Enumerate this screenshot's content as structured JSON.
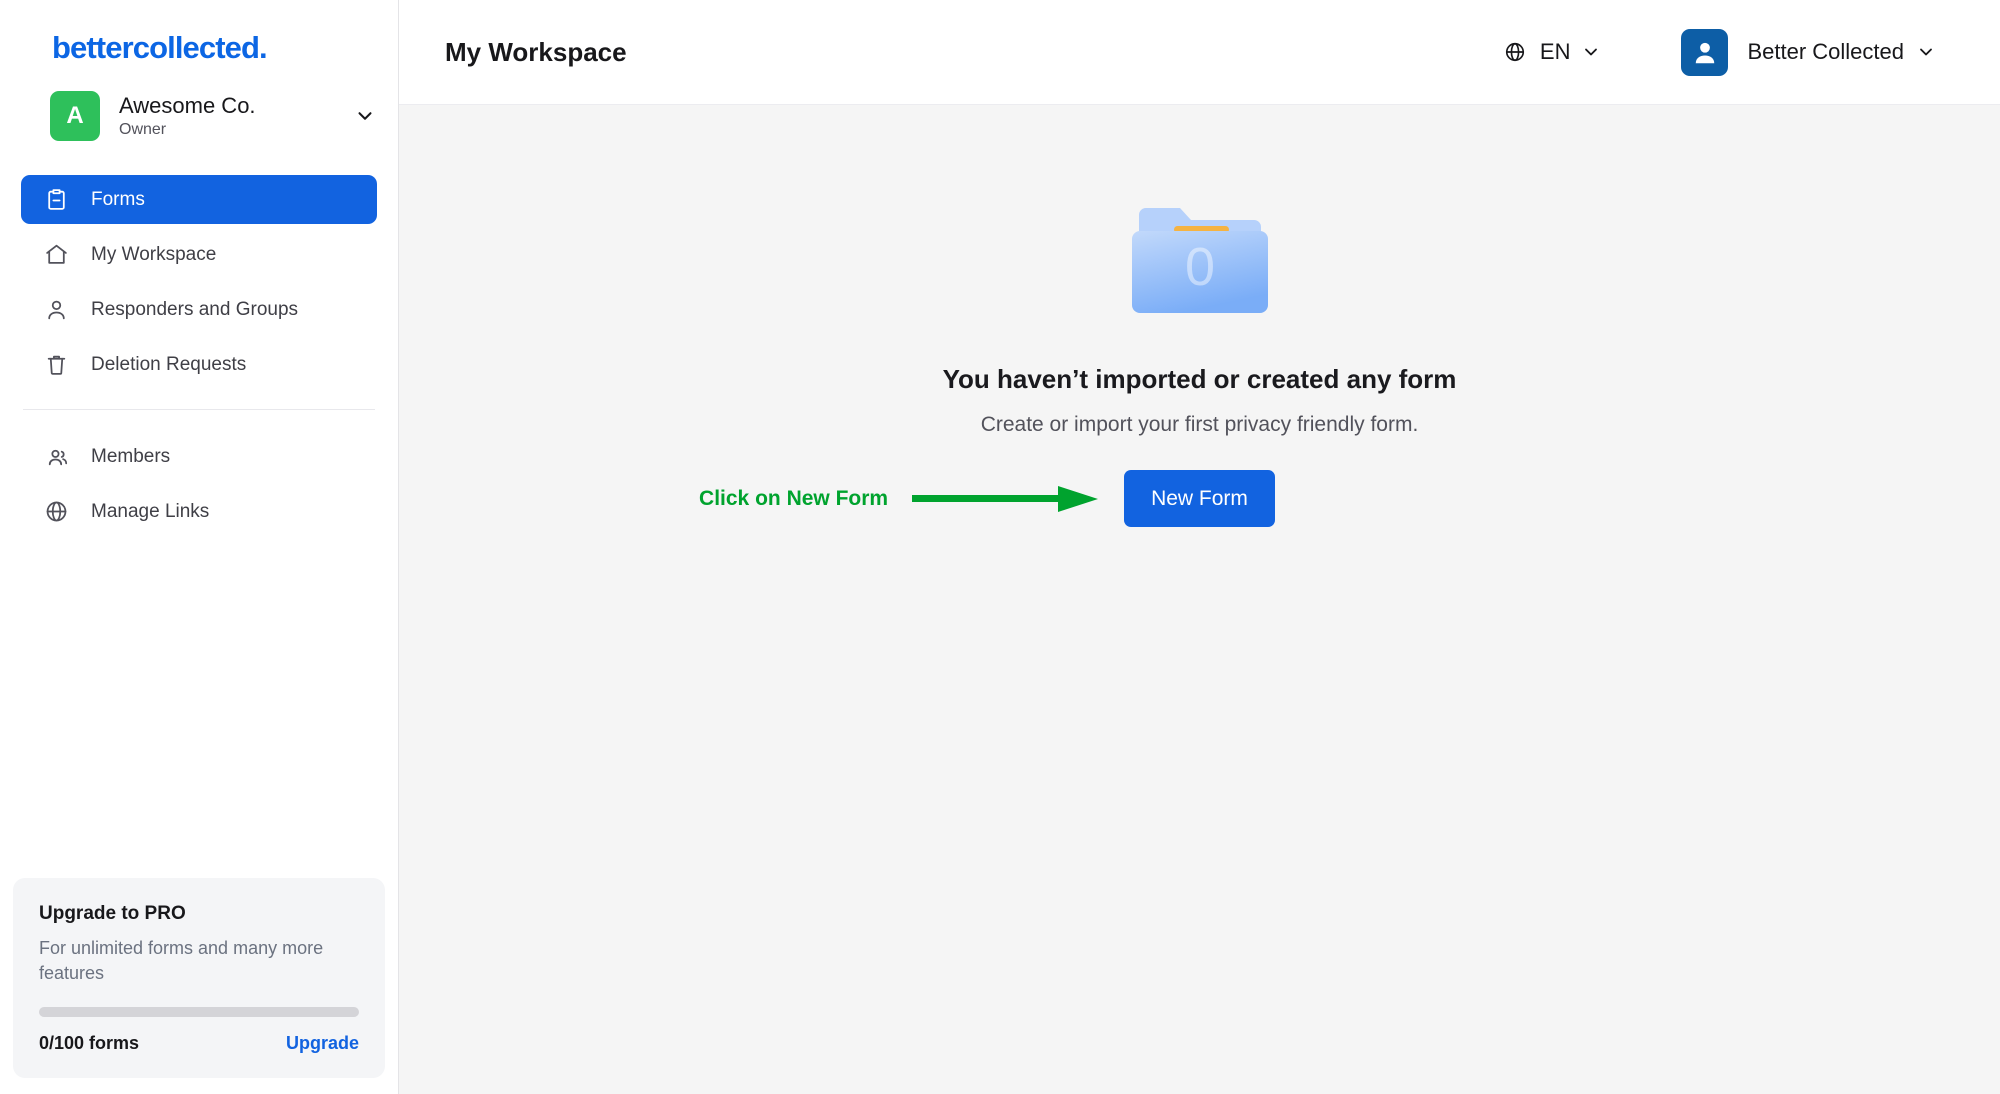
{
  "brand": {
    "logo_text": "bettercollected."
  },
  "workspace_switcher": {
    "avatar_initial": "A",
    "name": "Awesome Co.",
    "role": "Owner",
    "avatar_color": "#2ec05b",
    "chevron_icon": "chevron-down-icon"
  },
  "sidebar": {
    "items": [
      {
        "label": "Forms",
        "icon": "clipboard-icon",
        "active": true
      },
      {
        "label": "My Workspace",
        "icon": "home-icon",
        "active": false
      },
      {
        "label": "Responders and Groups",
        "icon": "person-icon",
        "active": false
      },
      {
        "label": "Deletion Requests",
        "icon": "trash-icon",
        "active": false
      }
    ],
    "items_secondary": [
      {
        "label": "Members",
        "icon": "people-icon",
        "active": false
      },
      {
        "label": "Manage Links",
        "icon": "globe-icon",
        "active": false
      }
    ],
    "active_color": "#1263e0"
  },
  "upgrade_card": {
    "title": "Upgrade to PRO",
    "subtitle": "For unlimited forms and many more features",
    "progress_percent": 0,
    "count_label": "0/100 forms",
    "link_label": "Upgrade",
    "link_color": "#1263e0"
  },
  "header": {
    "title": "My Workspace",
    "language": {
      "label": "EN",
      "icon": "globe-icon",
      "chevron_icon": "chevron-down-icon"
    },
    "user": {
      "name": "Better Collected",
      "avatar_icon": "user-avatar-icon",
      "avatar_color": "#0d5ea6",
      "chevron_icon": "chevron-down-icon"
    }
  },
  "empty_state": {
    "illustration": "empty-folder-icon",
    "folder_count": "0",
    "title": "You haven’t imported or created any form",
    "subtitle": "Create or import your first privacy friendly form.",
    "cta_label": "New Form",
    "cta_color": "#1263e0"
  },
  "annotation": {
    "text": "Click on New Form",
    "color": "#00a32e",
    "arrow_icon": "right-arrow-icon"
  }
}
